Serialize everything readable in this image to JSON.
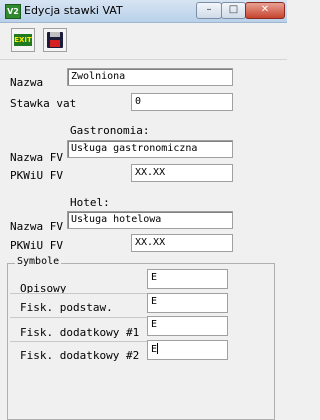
{
  "window": {
    "title": "Edycja stawki VAT",
    "app_icon_text": "V2",
    "minimize_symbol": "–",
    "maximize_symbol": "□",
    "close_symbol": "✕"
  },
  "toolbar": {
    "exit_label": "EXIT"
  },
  "form": {
    "nazwa_label": "Nazwa",
    "nazwa_value": "Zwolniona",
    "stawka_label": "Stawka vat",
    "stawka_value": "0",
    "gastronomia": {
      "title": "Gastronomia:",
      "nazwa_fv_label": "Nazwa FV",
      "nazwa_fv_value": "Usługa gastronomiczna",
      "pkwiu_label": "PKWiU FV",
      "pkwiu_value": "XX.XX"
    },
    "hotel": {
      "title": "Hotel:",
      "nazwa_fv_label": "Nazwa FV",
      "nazwa_fv_value": "Usługa hotelowa",
      "pkwiu_label": "PKWiU FV",
      "pkwiu_value": "XX.XX"
    },
    "symbole": {
      "title": "Symbole",
      "rows": [
        {
          "label": "Opisowy",
          "value": "E"
        },
        {
          "label": "Fisk. podstaw.",
          "value": "E"
        },
        {
          "label": "Fisk. dodatkowy #1",
          "value": "E"
        },
        {
          "label": "Fisk. dodatkowy #2",
          "value": "E"
        }
      ]
    }
  }
}
